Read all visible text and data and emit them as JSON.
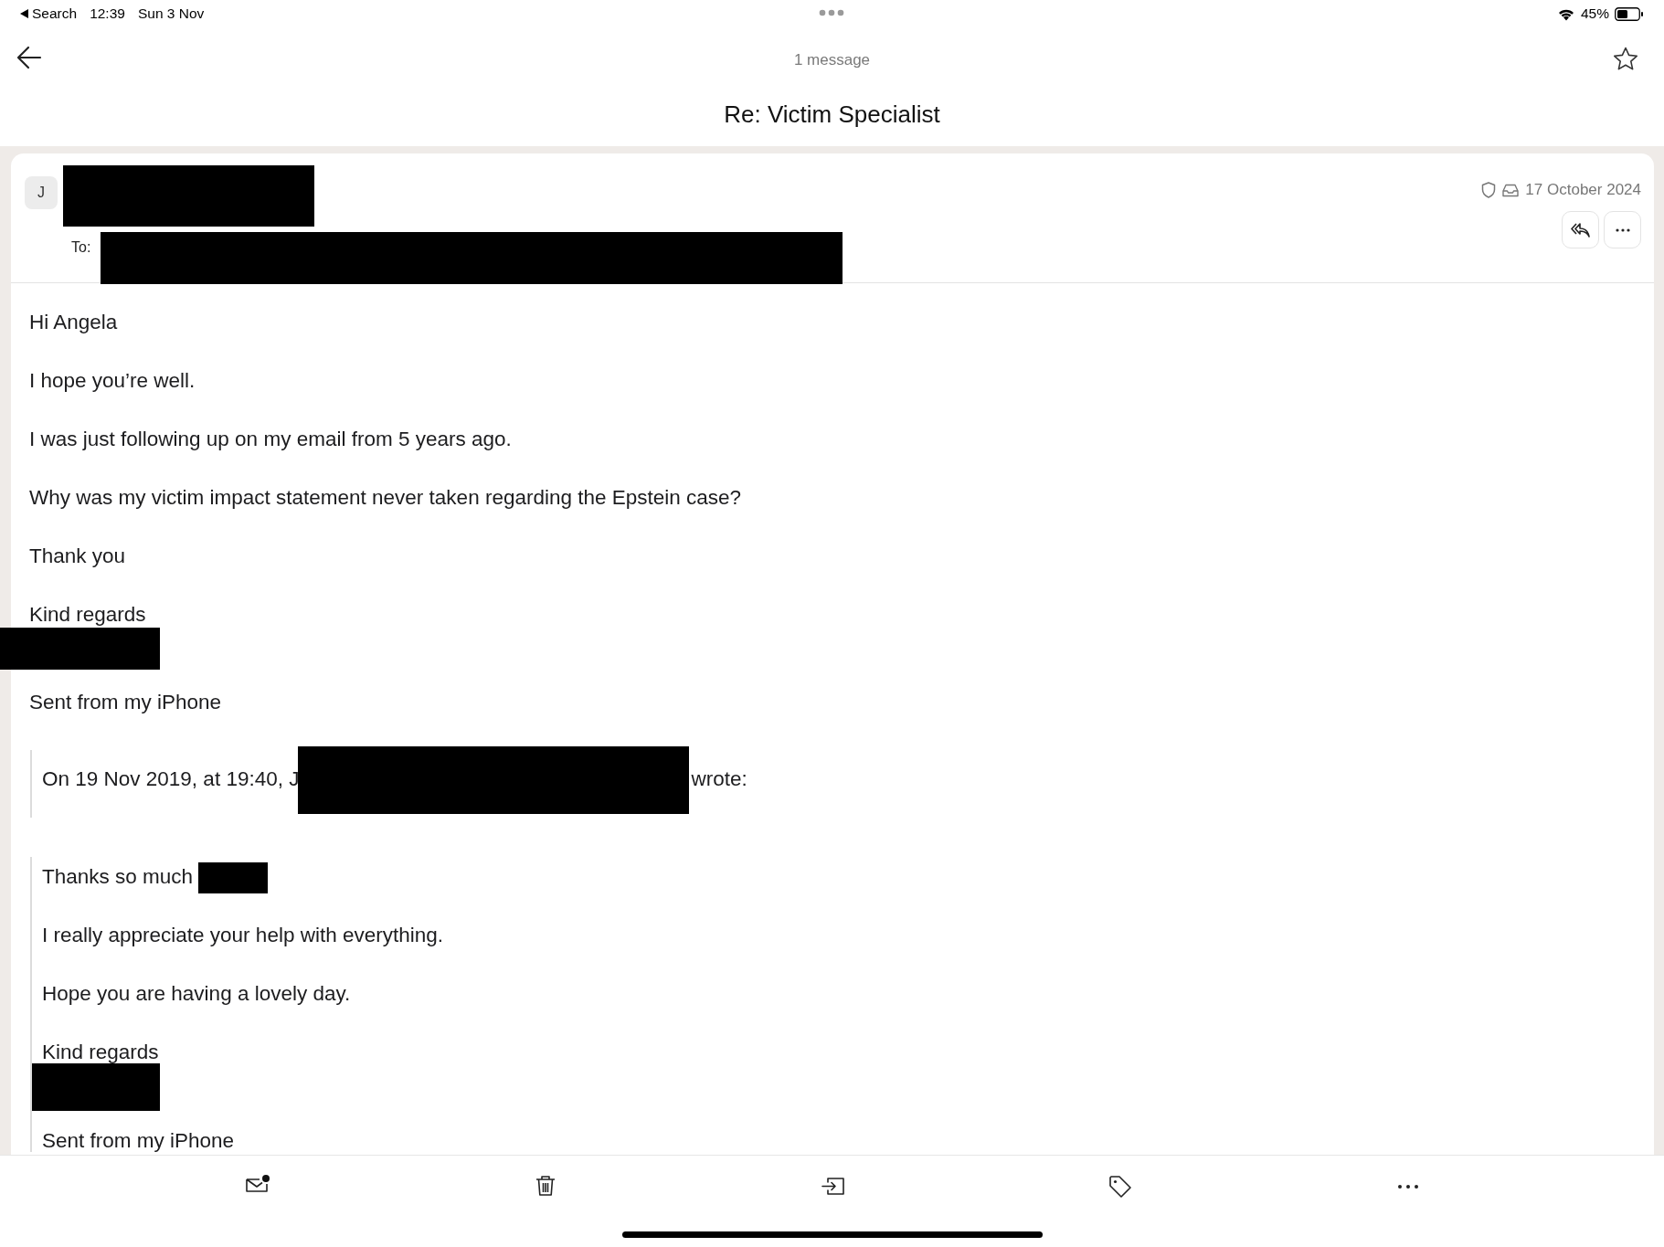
{
  "status_bar": {
    "back_label": "Search",
    "time": "12:39",
    "date": "Sun 3 Nov",
    "battery": "45%"
  },
  "nav": {
    "count": "1 message",
    "subject": "Re: Victim Specialist"
  },
  "message": {
    "avatar": "J",
    "to_label": "To:",
    "date": "17 October 2024",
    "body": [
      {
        "kind": "text",
        "text": "Hi Angela"
      },
      {
        "kind": "text",
        "text": "I hope you’re well."
      },
      {
        "kind": "text",
        "text": "I was just following up on my email from 5 years ago."
      },
      {
        "kind": "text",
        "text": "Why was my victim impact statement never taken regarding the Epstein case?"
      },
      {
        "kind": "text",
        "text": "Thank you"
      },
      {
        "kind": "text",
        "text": "Kind regards"
      },
      {
        "kind": "redaction"
      },
      {
        "kind": "text",
        "text": "Sent from my iPhone"
      }
    ],
    "quotes": [
      {
        "lines": [
          {
            "parts": [
              {
                "kind": "text",
                "text": "On 19 Nov 2019, at 19:40, J"
              },
              {
                "kind": "redaction"
              },
              {
                "kind": "text",
                "text": "wrote:"
              }
            ]
          }
        ]
      },
      {
        "lines": [
          {
            "parts": [
              {
                "kind": "text",
                "text": "Thanks so much"
              },
              {
                "kind": "redaction"
              }
            ]
          },
          {
            "parts": [
              {
                "kind": "text",
                "text": "I really appreciate your help with everything."
              }
            ]
          },
          {
            "parts": [
              {
                "kind": "text",
                "text": "Hope you are having a lovely day."
              }
            ]
          },
          {
            "parts": [
              {
                "kind": "text",
                "text": "Kind regards"
              }
            ]
          },
          {
            "parts": [
              {
                "kind": "redaction"
              }
            ]
          },
          {
            "parts": [
              {
                "kind": "text",
                "text": "Sent from my iPhone"
              }
            ]
          }
        ]
      }
    ]
  },
  "toolbar": [
    {
      "kind": "unread"
    },
    {
      "kind": "trash"
    },
    {
      "kind": "move"
    },
    {
      "kind": "tag"
    },
    {
      "kind": "more"
    }
  ]
}
